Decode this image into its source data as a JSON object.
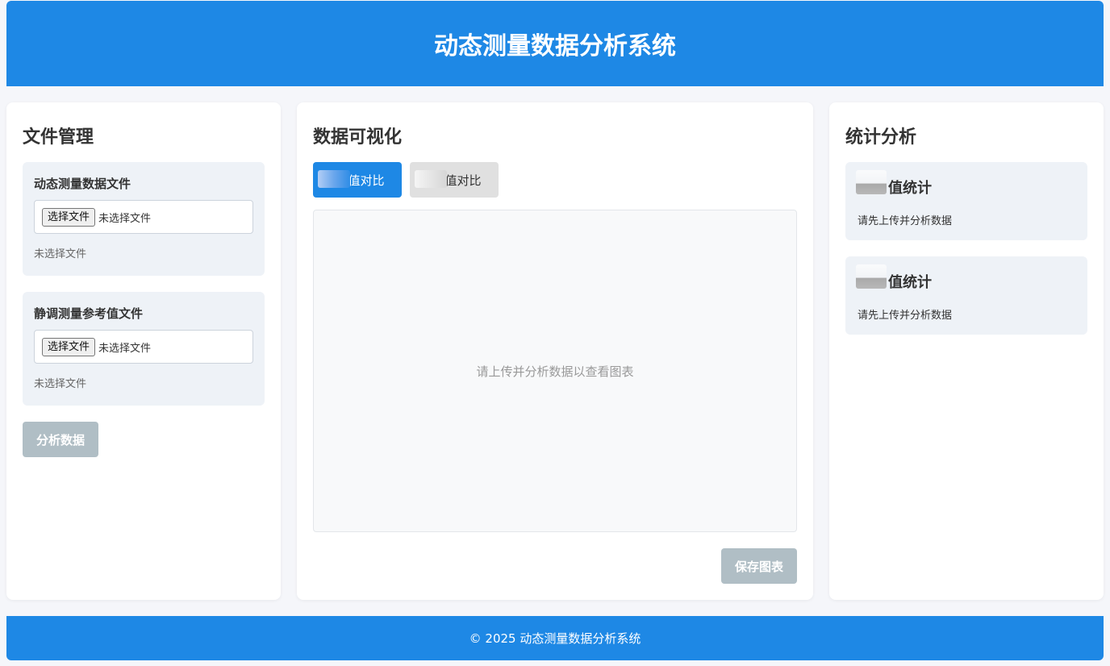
{
  "header": {
    "title": "动态测量数据分析系统"
  },
  "file_panel": {
    "title": "文件管理",
    "dynamic_file": {
      "label": "动态测量数据文件",
      "choose_label": "选择文件",
      "input_text": "未选择文件",
      "status": "未选择文件"
    },
    "static_file": {
      "label": "静调测量参考值文件",
      "choose_label": "选择文件",
      "input_text": "未选择文件",
      "status": "未选择文件"
    },
    "analyze_button": "分析数据"
  },
  "viz_panel": {
    "title": "数据可视化",
    "tabs": [
      {
        "label": "值对比",
        "active": true
      },
      {
        "label": "值对比",
        "active": false
      }
    ],
    "placeholder": "请上传并分析数据以查看图表",
    "save_button": "保存图表"
  },
  "stats_panel": {
    "title": "统计分析",
    "cards": [
      {
        "title": "值统计",
        "info": "请先上传并分析数据"
      },
      {
        "title": "值统计",
        "info": "请先上传并分析数据"
      }
    ]
  },
  "footer": {
    "text": "© 2025 动态测量数据分析系统"
  },
  "colors": {
    "primary": "#1e88e5",
    "disabled_button": "#b0bec5",
    "card_bg": "#eef2f7",
    "page_bg": "#f5f6fa"
  }
}
